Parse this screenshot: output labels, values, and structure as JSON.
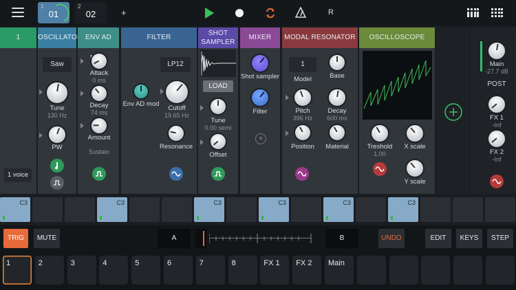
{
  "topbar": {
    "tab1": {
      "num": "1",
      "label": "01"
    },
    "tab2": {
      "num": "2",
      "label": "02"
    },
    "add_label": "+",
    "r_label": "R"
  },
  "track": {
    "header": "1",
    "voice_label": "1 voice"
  },
  "oscillator": {
    "title": "OSCILLATOR",
    "waveform": "Saw",
    "tune_label": "Tune",
    "tune_value": "130 Hz",
    "pw_label": "PW"
  },
  "env": {
    "title": "ENV AD MOD",
    "attack_label": "Attack",
    "attack_value": "0 ms",
    "decay_label": "Decay",
    "decay_value": "74 ms",
    "amount_label": "Amount",
    "sustain_label": "Sustain"
  },
  "filter": {
    "title": "FILTER",
    "type": "LP12",
    "env_label": "Env AD mod",
    "cutoff_label": "Cutoff",
    "cutoff_value": "19.65 Hz",
    "resonance_label": "Resonance"
  },
  "sampler": {
    "title_line1": "SHOT",
    "title_line2": "SAMPLER",
    "load_label": "LOAD",
    "tune_label": "Tune",
    "tune_value": "0.00 semi",
    "offset_label": "Offset"
  },
  "mixer": {
    "title": "MIXER",
    "shot_label": "Shot sampler",
    "filter_label": "Filter",
    "add_label": "+"
  },
  "modal": {
    "title": "MODAL RESONATOR",
    "model_value": "1",
    "model_label": "Model",
    "base_label": "Base",
    "pitch_label": "Pitch",
    "pitch_value": "396 Hz",
    "decay_label": "Decay",
    "decay_value": "600 ms",
    "position_label": "Position",
    "material_label": "Material"
  },
  "scope": {
    "title": "OSCILLOSCOPE",
    "threshold_label": "Treshold",
    "threshold_value": "1.00",
    "xscale_label": "X scale",
    "yscale_label": "Y scale"
  },
  "output": {
    "main_label": "Main",
    "main_value": "-27.7 dB",
    "post_label": "POST",
    "fx1_label": "FX 1",
    "fx1_value": "-Inf",
    "fx2_label": "FX 2",
    "fx2_value": "-Inf"
  },
  "steps": [
    "C3",
    "",
    "",
    "C3",
    "",
    "",
    "C3",
    "",
    "C3",
    "",
    "C3",
    "",
    "C3",
    "",
    "",
    ""
  ],
  "controls": {
    "trig": "TRIG",
    "mute": "MUTE",
    "a": "A",
    "b": "B",
    "undo": "UNDO",
    "edit": "EDIT",
    "keys": "KEYS",
    "step": "STEP"
  },
  "pads": [
    "1",
    "2",
    "3",
    "4",
    "5",
    "6",
    "7",
    "8",
    "FX 1",
    "FX 2",
    "Main",
    "",
    "",
    "",
    "",
    ""
  ],
  "colors": {
    "oscillator": "#3a7fa1",
    "env": "#3d8e86",
    "filter": "#3a6592",
    "sampler": "#5b4aa8",
    "mixer": "#8a4a96",
    "modal": "#8a3a3e",
    "scope": "#6b8a3a",
    "track": "#2a9a66",
    "trig": "#e86a3a"
  }
}
